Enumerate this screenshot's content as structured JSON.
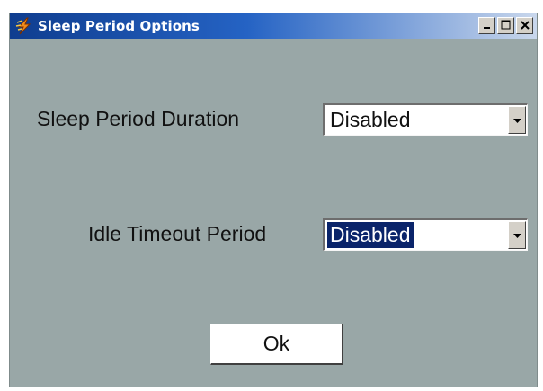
{
  "window": {
    "title": "Sleep Period Options",
    "app_icon": "lightning-icon",
    "controls": [
      "minimize-icon",
      "maximize-icon",
      "close-icon"
    ]
  },
  "form": {
    "sleep_period": {
      "label": "Sleep Period Duration",
      "value": "Disabled"
    },
    "idle_timeout": {
      "label": "Idle Timeout Period",
      "value": "Disabled"
    },
    "ok_label": "Ok"
  },
  "colors": {
    "window_bg": "#99a7a7",
    "titlebar_start": "#0f3d8f",
    "titlebar_end": "#c9d7ec",
    "selection": "#0a246a"
  }
}
